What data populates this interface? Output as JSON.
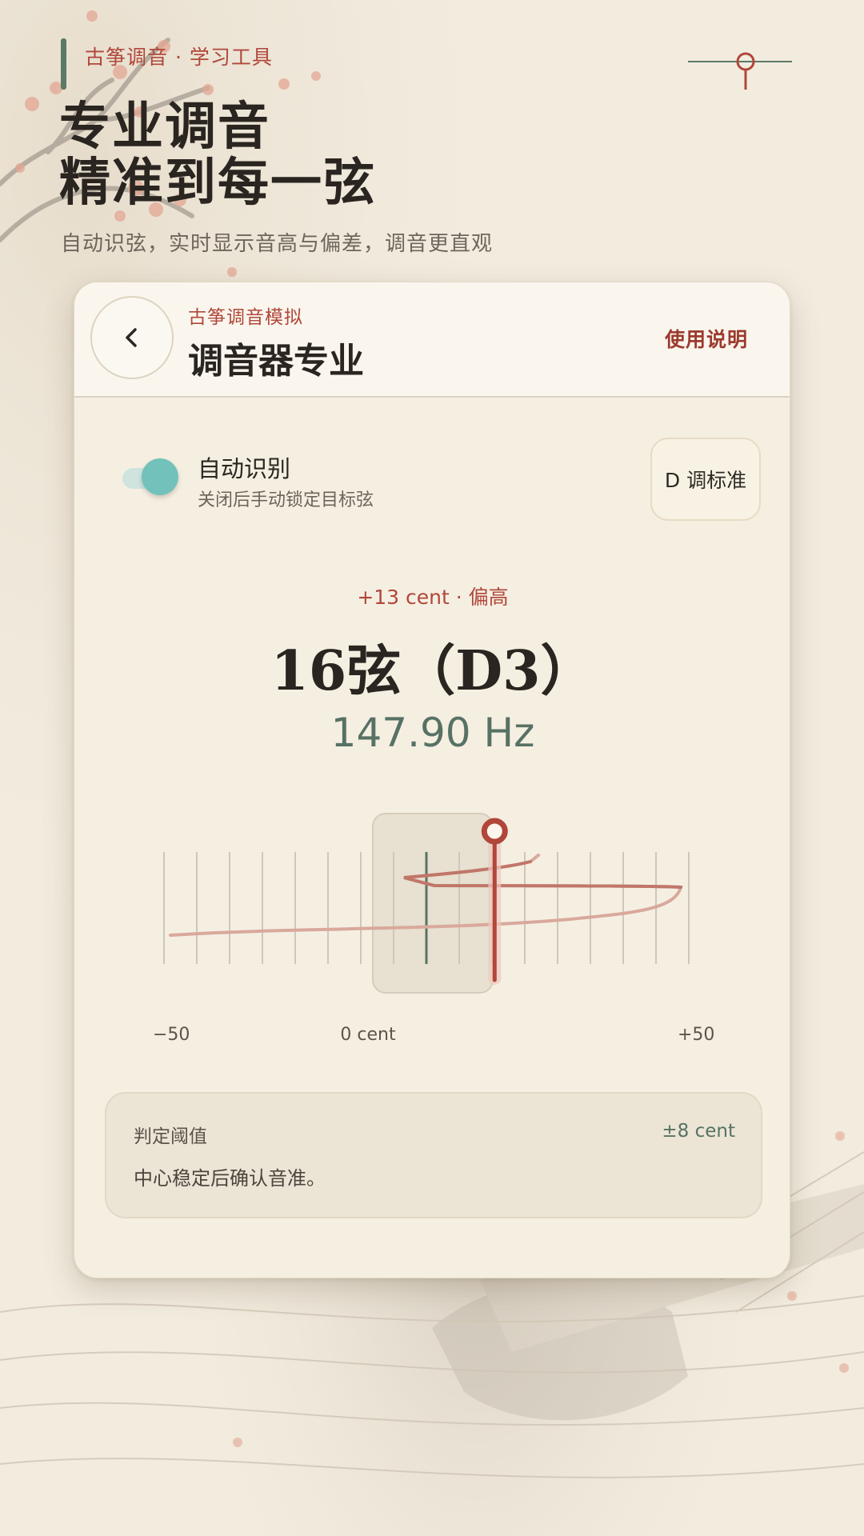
{
  "header": {
    "tag": "古筝调音 · 学习工具",
    "title_line1": "专业调音",
    "title_line2": "精准到每一弦",
    "subtitle": "自动识弦，实时显示音高与偏差，调音更直观"
  },
  "card": {
    "back_icon": "chevron-left-icon",
    "subtitle": "古筝调音模拟",
    "title": "调音器专业",
    "help_label": "使用说明"
  },
  "auto_detect": {
    "enabled": true,
    "label": "自动识别",
    "hint": "关闭后手动锁定目标弦"
  },
  "tuning_preset": "D 调标准",
  "reading": {
    "deviation": "+13 cent · 偏高",
    "deviation_cents": 13,
    "note": "16弦（D3）",
    "frequency": "147.90 Hz"
  },
  "meter": {
    "min_label": "−50",
    "zero_label": "0 cent",
    "max_label": "+50",
    "range": [
      -50,
      50
    ]
  },
  "threshold": {
    "label": "判定阈值",
    "value": "±8 cent",
    "description": "中心稳定后确认音准。"
  },
  "colors": {
    "accent_red": "#b0473a",
    "accent_green": "#577265",
    "toggle_teal": "#73c1bb",
    "background": "#efe8da",
    "card": "#f5efe2"
  }
}
